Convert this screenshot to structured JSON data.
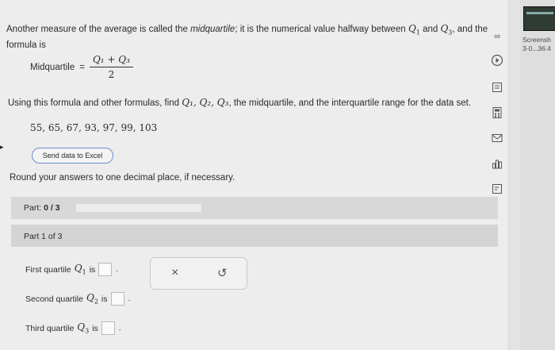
{
  "intro": {
    "text_a": "Another measure of the average is called the ",
    "term": "midquartile",
    "text_b": "; it is the numerical value halfway between ",
    "q1": "Q",
    "q1_sub": "1",
    "and": " and ",
    "q3": "Q",
    "q3_sub": "3",
    "text_c": ", and the formula is"
  },
  "formula": {
    "label": "Midquartile",
    "equals": "=",
    "numerator": "Q₁ + Q₃",
    "denominator": "2"
  },
  "question": {
    "lead": "Using this formula and other formulas, find ",
    "vars": "Q₁, Q₂, Q₃",
    "tail": ", the midquartile, and the interquartile range for the data set."
  },
  "dataset": "55, 65, 67, 93, 97, 99, 103",
  "excel_button": "Send data to Excel",
  "round_note": "Round your answers to one decimal place, if necessary.",
  "part": {
    "label": "Part:",
    "value": "0 / 3",
    "progress_fraction": 0
  },
  "part1_title": "Part 1 of 3",
  "answers": [
    {
      "prefix": "First quartile ",
      "var": "Q",
      "sub": "1",
      "suffix": " is",
      "value": ""
    },
    {
      "prefix": "Second quartile ",
      "var": "Q",
      "sub": "2",
      "suffix": " is",
      "value": ""
    },
    {
      "prefix": "Third quartile ",
      "var": "Q",
      "sub": "3",
      "suffix": " is",
      "value": ""
    }
  ],
  "tools": {
    "clear": "×",
    "undo": "↺"
  },
  "sidebar_icons": [
    "infinity-icon",
    "play-icon",
    "book-icon",
    "calculator-icon",
    "mail-icon",
    "chart-icon",
    "glossary-icon"
  ],
  "screenshot_caption": [
    "Screensh",
    "3-0...36.4"
  ]
}
